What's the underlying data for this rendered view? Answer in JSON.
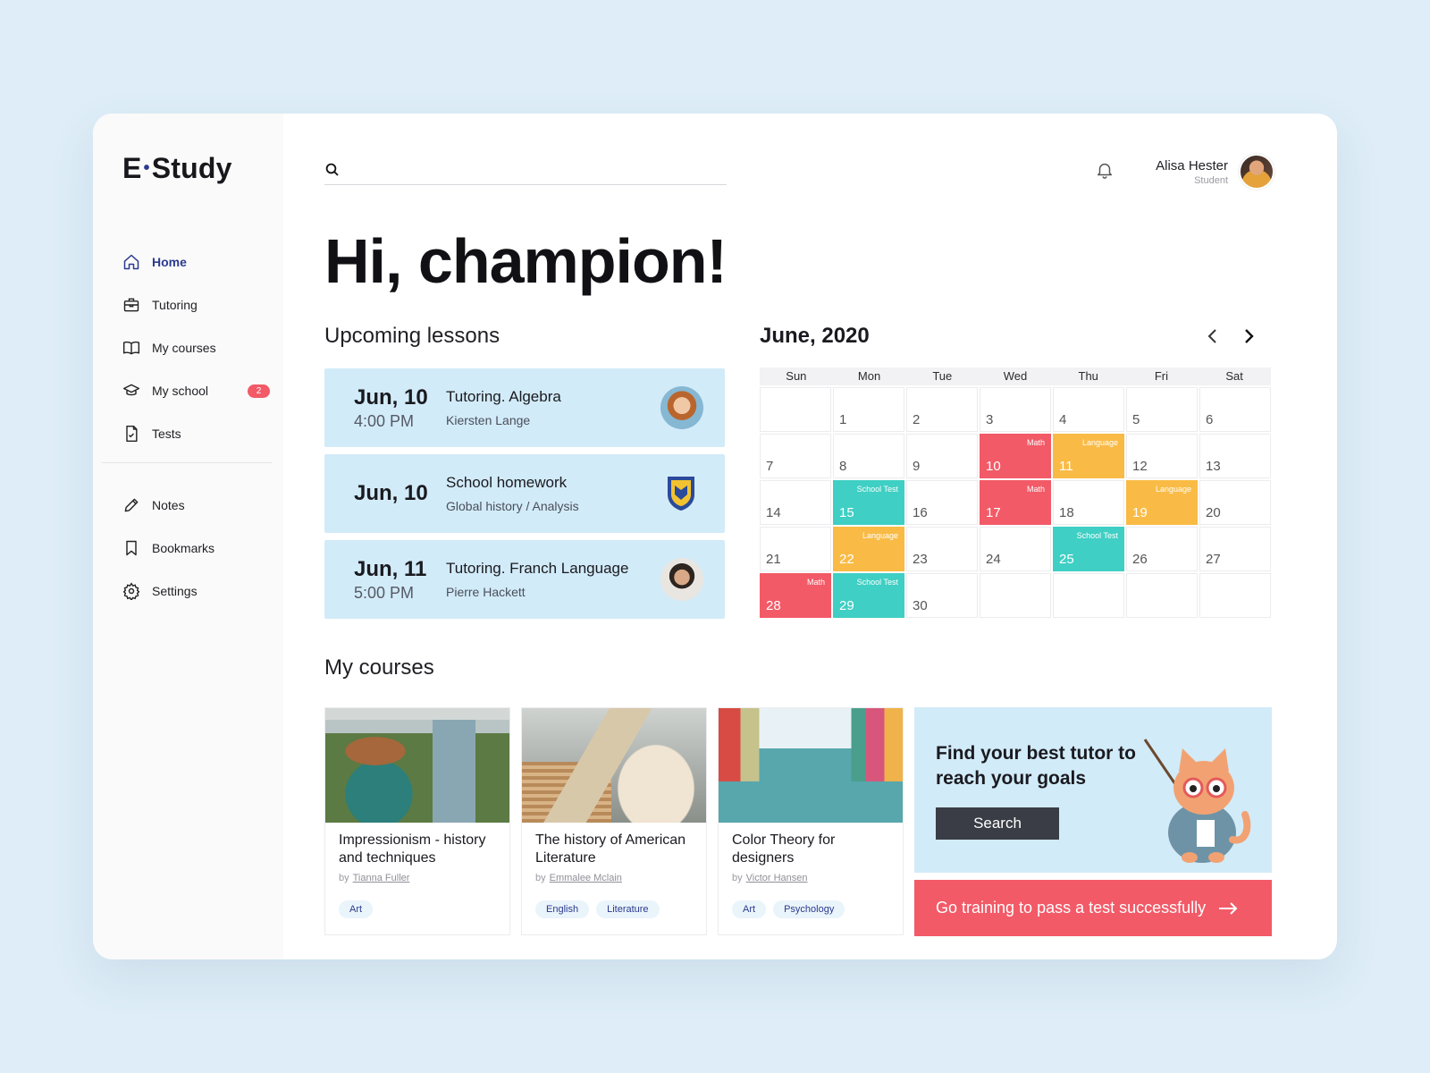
{
  "app": {
    "logo_left": "E",
    "logo_dot": "•",
    "logo_right": "Study"
  },
  "sidebar": {
    "items": [
      {
        "label": "Home",
        "icon": "home-icon"
      },
      {
        "label": "Tutoring",
        "icon": "briefcase-icon"
      },
      {
        "label": "My courses",
        "icon": "book-icon"
      },
      {
        "label": "My school",
        "icon": "graduation-cap-icon",
        "badge": "2"
      },
      {
        "label": "Tests",
        "icon": "document-check-icon"
      }
    ],
    "secondary": [
      {
        "label": "Notes",
        "icon": "pencil-icon"
      },
      {
        "label": "Bookmarks",
        "icon": "bookmark-icon"
      },
      {
        "label": "Settings",
        "icon": "gear-icon"
      }
    ]
  },
  "header": {
    "search_placeholder": "",
    "user_name": "Alisa Hester",
    "user_role": "Student"
  },
  "greeting": "Hi, champion!",
  "upcoming": {
    "title": "Upcoming lessons",
    "lessons": [
      {
        "day": "Jun, 10",
        "time": "4:00 PM",
        "title": "Tutoring. Algebra",
        "sub": "Kiersten Lange"
      },
      {
        "day": "Jun, 10",
        "time": "",
        "title": "School homework",
        "sub": "Global history / Analysis"
      },
      {
        "day": "Jun, 11",
        "time": "5:00 PM",
        "title": "Tutoring. Franch Language",
        "sub": "Pierre Hackett"
      }
    ]
  },
  "calendar": {
    "title": "June, 2020",
    "weekdays": [
      "Sun",
      "Mon",
      "Tue",
      "Wed",
      "Thu",
      "Fri",
      "Sat"
    ],
    "colors": {
      "Math": "#f25a67",
      "Language": "#f9bb45",
      "School Test": "#3fcfc4"
    },
    "days": [
      {
        "n": "",
        "tag": ""
      },
      {
        "n": "1",
        "tag": ""
      },
      {
        "n": "2",
        "tag": ""
      },
      {
        "n": "3",
        "tag": ""
      },
      {
        "n": "4",
        "tag": ""
      },
      {
        "n": "5",
        "tag": ""
      },
      {
        "n": "6",
        "tag": ""
      },
      {
        "n": "7",
        "tag": ""
      },
      {
        "n": "8",
        "tag": ""
      },
      {
        "n": "9",
        "tag": ""
      },
      {
        "n": "10",
        "tag": "Math"
      },
      {
        "n": "11",
        "tag": "Language"
      },
      {
        "n": "12",
        "tag": ""
      },
      {
        "n": "13",
        "tag": ""
      },
      {
        "n": "14",
        "tag": ""
      },
      {
        "n": "15",
        "tag": "School Test"
      },
      {
        "n": "16",
        "tag": ""
      },
      {
        "n": "17",
        "tag": "Math"
      },
      {
        "n": "18",
        "tag": ""
      },
      {
        "n": "19",
        "tag": "Language"
      },
      {
        "n": "20",
        "tag": ""
      },
      {
        "n": "21",
        "tag": ""
      },
      {
        "n": "22",
        "tag": "Language"
      },
      {
        "n": "23",
        "tag": ""
      },
      {
        "n": "24",
        "tag": ""
      },
      {
        "n": "25",
        "tag": "School Test"
      },
      {
        "n": "26",
        "tag": ""
      },
      {
        "n": "27",
        "tag": ""
      },
      {
        "n": "28",
        "tag": "Math"
      },
      {
        "n": "29",
        "tag": "School Test"
      },
      {
        "n": "30",
        "tag": ""
      },
      {
        "n": "",
        "tag": ""
      },
      {
        "n": "",
        "tag": ""
      },
      {
        "n": "",
        "tag": ""
      },
      {
        "n": "",
        "tag": ""
      }
    ]
  },
  "courses": {
    "title": "My courses",
    "by": "by",
    "items": [
      {
        "title": "Impressionism - history and techniques",
        "author": "Tianna Fuller",
        "tags": [
          "Art"
        ]
      },
      {
        "title": "The history of American Literature",
        "author": "Emmalee Mclain",
        "tags": [
          "English",
          "Literature"
        ]
      },
      {
        "title": "Color Theory for designers",
        "author": "Victor Hansen",
        "tags": [
          "Art",
          "Psychology"
        ]
      }
    ]
  },
  "promo": {
    "text": "Find your best tutor to reach your goals",
    "button": "Search"
  },
  "cta": {
    "label": "Go training to pass a test successfully"
  }
}
